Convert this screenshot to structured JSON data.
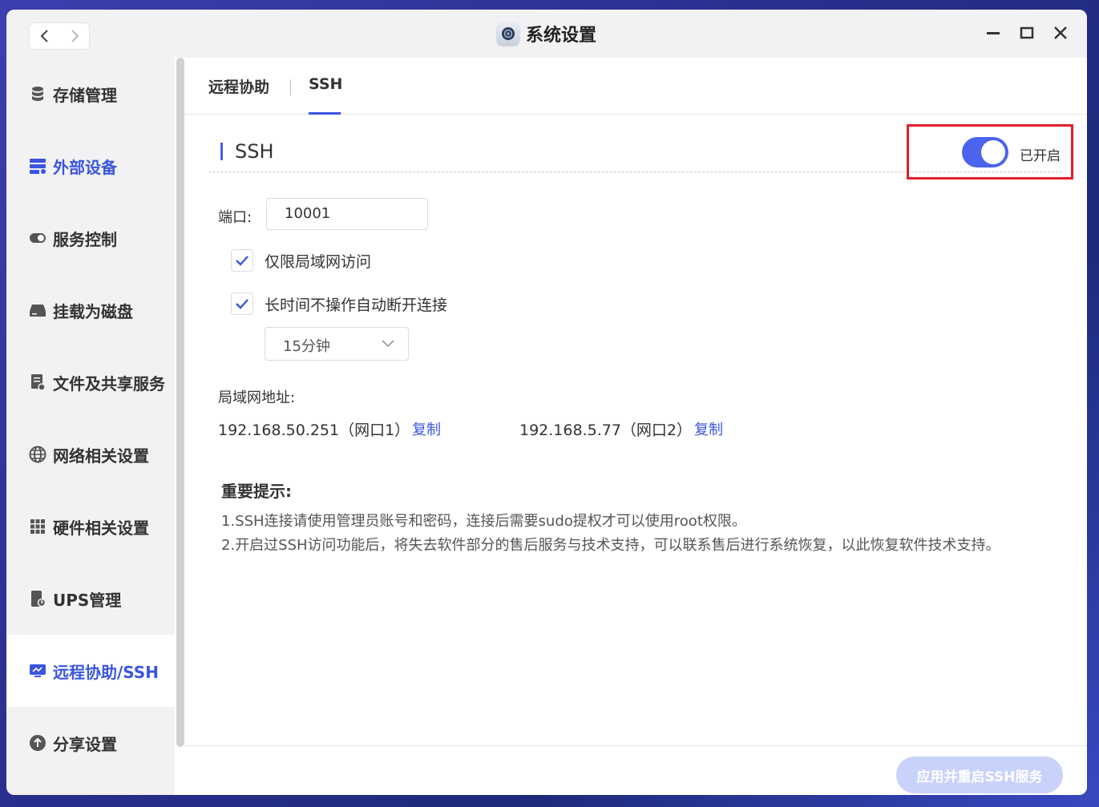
{
  "window": {
    "title": "系统设置",
    "controls": [
      "minimize-icon",
      "maximize-icon",
      "close-icon"
    ]
  },
  "sidebar": {
    "items": [
      {
        "label": "存储管理",
        "icon": "database-icon"
      },
      {
        "label": "外部设备",
        "icon": "external-device-icon"
      },
      {
        "label": "服务控制",
        "icon": "toggle-icon"
      },
      {
        "label": "挂载为磁盘",
        "icon": "disk-icon"
      },
      {
        "label": "文件及共享服务",
        "icon": "file-share-icon"
      },
      {
        "label": "网络相关设置",
        "icon": "globe-icon"
      },
      {
        "label": "硬件相关设置",
        "icon": "grid-icon"
      },
      {
        "label": "UPS管理",
        "icon": "ups-icon"
      },
      {
        "label": "远程协助/SSH",
        "icon": "remote-icon"
      },
      {
        "label": "分享设置",
        "icon": "share-icon"
      }
    ],
    "active_index": 8
  },
  "tabs": [
    {
      "label": "远程协助"
    },
    {
      "label": "SSH"
    }
  ],
  "ssh": {
    "section_title": "SSH",
    "toggle_state_label": "已开启",
    "enabled": true,
    "port_label": "端口:",
    "port_value": "10001",
    "lan_only_label": "仅限局域网访问",
    "lan_only_checked": true,
    "auto_disconnect_label": "长时间不操作自动断开连接",
    "auto_disconnect_checked": true,
    "timeout_selected": "15分钟",
    "lan_address_label": "局域网地址:",
    "addresses": [
      {
        "ip": "192.168.50.251（网口1）",
        "copy_label": "复制"
      },
      {
        "ip": "192.168.5.77（网口2）",
        "copy_label": "复制"
      }
    ],
    "notes_title": "重要提示:",
    "notes": [
      "1.SSH连接请使用管理员账号和密码，连接后需要sudo提权才可以使用root权限。",
      "2.开启过SSH访问功能后，将失去软件部分的售后服务与技术支持，可以联系售后进行系统恢复，以此恢复软件技术支持。"
    ],
    "apply_button": "应用并重启SSH服务"
  },
  "colors": {
    "accent": "#3a55e0",
    "toggle_on": "#4a64ee",
    "highlight": "#e21d2b",
    "apply_disabled": "#c9d2fb"
  }
}
